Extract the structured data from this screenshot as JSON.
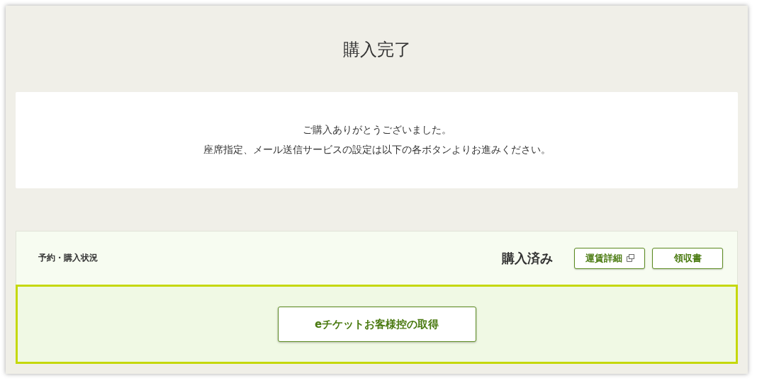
{
  "title": "購入完了",
  "message": {
    "lines": [
      "ご購入ありがとうございました。",
      "座席指定、メール送信サービスの設定は以下の各ボタンよりお進みください。"
    ]
  },
  "status": {
    "label": "予約・購入状況",
    "value": "購入済み",
    "buttons": [
      {
        "label": "運賃詳細",
        "kind": "external"
      },
      {
        "label": "領収書",
        "kind": "plain"
      }
    ]
  },
  "action": {
    "label": "eチケットお客様控の取得"
  }
}
